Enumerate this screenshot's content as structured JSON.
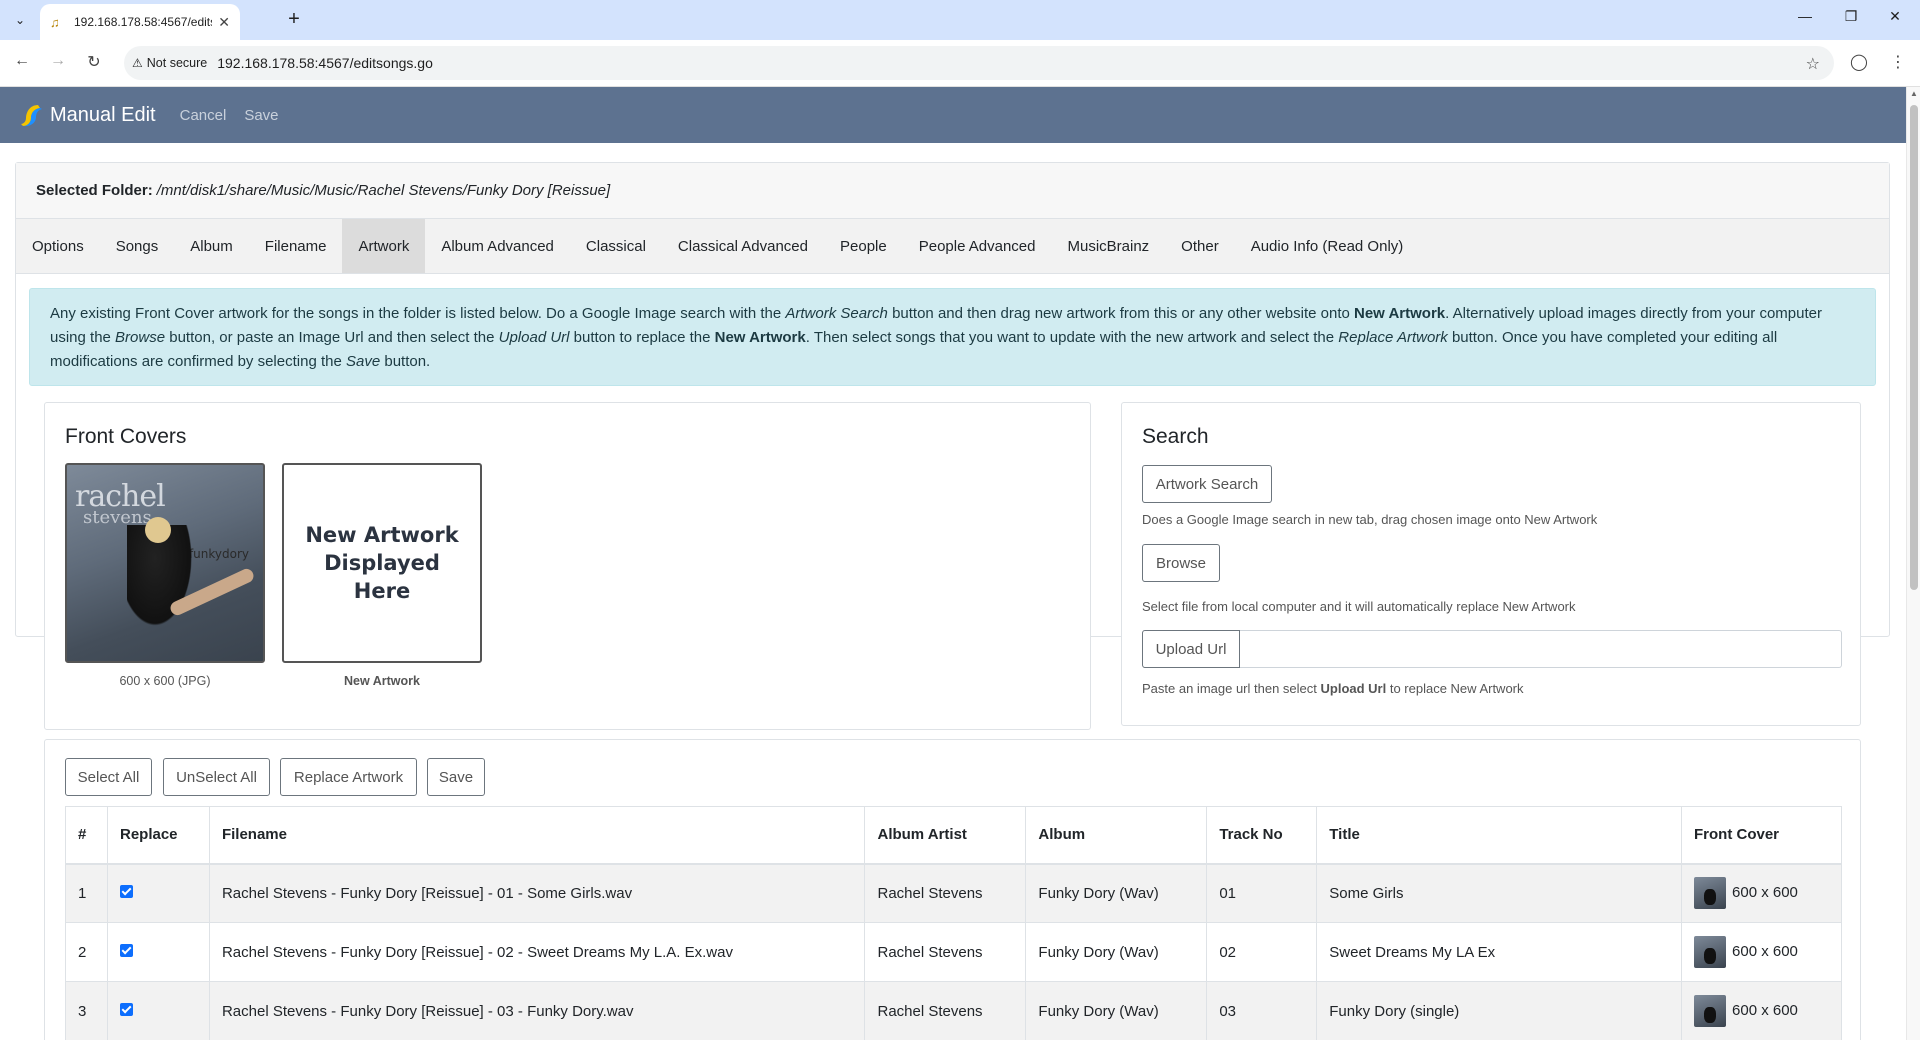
{
  "browser": {
    "tab_title": "192.168.178.58:4567/editsongs.go",
    "security_label": "Not secure",
    "url": "192.168.178.58:4567/editsongs.go"
  },
  "app": {
    "brand": "Manual Edit",
    "nav_cancel": "Cancel",
    "nav_save": "Save"
  },
  "folder": {
    "label": "Selected Folder:",
    "path": "/mnt/disk1/share/Music/Music/Rachel Stevens/Funky Dory [Reissue]"
  },
  "tabs": [
    "Options",
    "Songs",
    "Album",
    "Filename",
    "Artwork",
    "Album Advanced",
    "Classical",
    "Classical Advanced",
    "People",
    "People Advanced",
    "MusicBrainz",
    "Other",
    "Audio Info (Read Only)"
  ],
  "active_tab": "Artwork",
  "info": {
    "p1": "Any existing Front Cover artwork for the songs in the folder is listed below. Do a Google Image search with the ",
    "i1": "Artwork Search",
    "p2": " button and then drag new artwork from this or any other website onto ",
    "b1": "New Artwork",
    "p3": ". Alternatively upload images directly from your computer using the ",
    "i2": "Browse",
    "p4": " button, or paste an Image Url and then select the ",
    "i3": "Upload Url",
    "p5": " button to replace the ",
    "b2": "New Artwork",
    "p6": ". Then select songs that you want to update with the new artwork and select the ",
    "i4": "Replace Artwork",
    "p7": " button. Once you have completed your editing all modifications are confirmed by selecting the ",
    "i5": "Save",
    "p8": " button."
  },
  "covers": {
    "heading": "Front Covers",
    "cover_art_text_1": "rachel",
    "cover_art_text_2": "stevens",
    "cover_art_text_3": "funkydory",
    "existing_caption": "600 x 600 (JPG)",
    "new_art_text": "New Artwork Displayed Here",
    "new_caption": "New Artwork"
  },
  "search": {
    "heading": "Search",
    "artwork_search_btn": "Artwork Search",
    "artwork_search_hint": "Does a Google Image search in new tab, drag chosen image onto New Artwork",
    "browse_btn": "Browse",
    "browse_hint": "Select file from local computer and it will automatically replace New Artwork",
    "upload_btn": "Upload Url",
    "upload_value": "",
    "upload_hint_1": "Paste an image url then select ",
    "upload_hint_b": "Upload Url",
    "upload_hint_2": " to replace New Artwork"
  },
  "actions": {
    "select_all": "Select All",
    "unselect_all": "UnSelect All",
    "replace_artwork": "Replace Artwork",
    "save": "Save"
  },
  "table": {
    "headers": [
      "#",
      "Replace",
      "Filename",
      "Album Artist",
      "Album",
      "Track No",
      "Title",
      "Front Cover"
    ],
    "rows": [
      {
        "num": "1",
        "replace": true,
        "filename": "Rachel Stevens - Funky Dory [Reissue] - 01 - Some Girls.wav",
        "album_artist": "Rachel Stevens",
        "album": "Funky Dory (Wav)",
        "track": "01",
        "title": "Some Girls",
        "cover": "600 x 600"
      },
      {
        "num": "2",
        "replace": true,
        "filename": "Rachel Stevens - Funky Dory [Reissue] - 02 - Sweet Dreams My L.A. Ex.wav",
        "album_artist": "Rachel Stevens",
        "album": "Funky Dory (Wav)",
        "track": "02",
        "title": "Sweet Dreams My LA Ex",
        "cover": "600 x 600"
      },
      {
        "num": "3",
        "replace": true,
        "filename": "Rachel Stevens - Funky Dory [Reissue] - 03 - Funky Dory.wav",
        "album_artist": "Rachel Stevens",
        "album": "Funky Dory (Wav)",
        "track": "03",
        "title": "Funky Dory (single)",
        "cover": "600 x 600"
      }
    ]
  }
}
